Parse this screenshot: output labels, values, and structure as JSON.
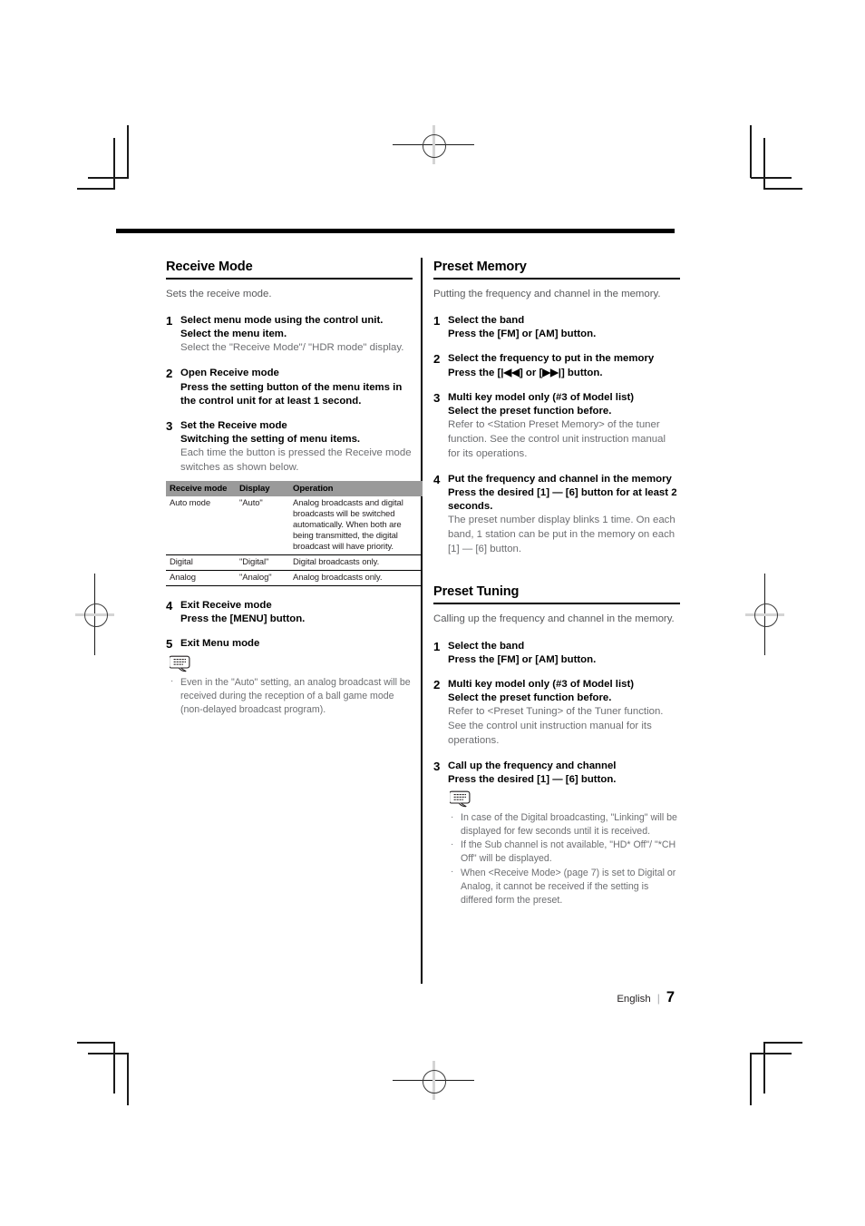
{
  "page": {
    "footer_language": "English",
    "footer_separator": "|",
    "footer_page_number": "7"
  },
  "left_column": {
    "section": {
      "heading": "Receive Mode",
      "intro": "Sets the receive mode.",
      "steps": [
        {
          "number": "1",
          "title": "Select menu mode using the control unit.",
          "subtitle": "Select the menu item.",
          "description": "Select the \"Receive Mode\"/ \"HDR mode\" display."
        },
        {
          "number": "2",
          "title": "Open Receive mode",
          "subtitle": "Press the setting button of the menu items in the control unit for at least 1 second.",
          "description": ""
        },
        {
          "number": "3",
          "title": "Set the Receive mode",
          "subtitle": "Switching the setting of menu items.",
          "description": "Each time the button is pressed the Receive mode switches as shown below."
        },
        {
          "number": "4",
          "title": "Exit Receive mode",
          "subtitle": "Press the [MENU] button.",
          "description": ""
        },
        {
          "number": "5",
          "title": "Exit Menu mode",
          "subtitle": "",
          "description": ""
        }
      ],
      "table": {
        "headers": [
          "Receive mode",
          "Display",
          "Operation"
        ],
        "rows": [
          [
            "Auto mode",
            "\"Auto\"",
            "Analog broadcasts and digital broadcasts will be switched automatically. When both are being transmitted, the digital broadcast will have priority."
          ],
          [
            "Digital",
            "\"Digital\"",
            "Digital broadcasts only."
          ],
          [
            "Analog",
            "\"Analog\"",
            "Analog broadcasts only."
          ]
        ]
      },
      "note_icon": "note-speech-bubble-icon",
      "notes": [
        "Even in the \"Auto\" setting, an analog broadcast will be received during the reception of a ball game mode (non-delayed broadcast program)."
      ]
    }
  },
  "right_column": {
    "section_preset_memory": {
      "heading": "Preset Memory",
      "intro": "Putting the frequency and channel in the memory.",
      "steps": [
        {
          "number": "1",
          "title": "Select the band",
          "subtitle": "Press the [FM] or [AM] button.",
          "description": ""
        },
        {
          "number": "2",
          "title": "Select the frequency to put in the memory",
          "subtitle": "Press the [|◀◀] or [▶▶|] button.",
          "description": ""
        },
        {
          "number": "3",
          "title": "Multi key model only (#3 of Model list)",
          "subtitle": "Select the preset function before.",
          "description": "Refer to <Station Preset Memory> of the tuner function. See the control unit instruction manual for its operations."
        },
        {
          "number": "4",
          "title": "Put the frequency and channel in the memory",
          "subtitle": "Press the desired [1] — [6] button for at least 2 seconds.",
          "description": "The preset number display blinks 1 time. On each band, 1 station can be put in the memory on each [1] — [6] button."
        }
      ]
    },
    "section_preset_tuning": {
      "heading": "Preset Tuning",
      "intro": "Calling up the frequency and channel in the memory.",
      "steps": [
        {
          "number": "1",
          "title": "Select the band",
          "subtitle": "Press the [FM] or [AM] button.",
          "description": ""
        },
        {
          "number": "2",
          "title": "Multi key model only (#3 of Model list)",
          "subtitle": "Select the preset function before.",
          "description": "Refer to <Preset Tuning> of the Tuner function. See the control unit instruction manual for its operations."
        },
        {
          "number": "3",
          "title": "Call up the frequency and channel",
          "subtitle": "Press the desired [1] — [6] button.",
          "description": ""
        }
      ],
      "note_icon": "note-speech-bubble-icon",
      "notes": [
        "In case of the Digital broadcasting, \"Linking\" will be displayed for few seconds until it is received.",
        "If the Sub channel is not available, \"HD* Off\"/ \"*CH Off\" will be displayed.",
        "When <Receive Mode> (page 7)  is set to Digital or Analog, it cannot be received if the setting is differed form the preset."
      ]
    }
  }
}
